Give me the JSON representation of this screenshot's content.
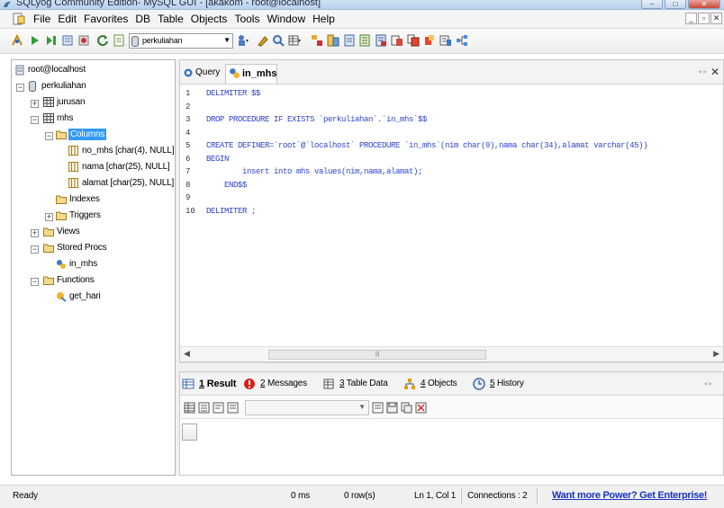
{
  "window": {
    "title": "SQLyog Community Edition- MySQL GUI - [akakom - root@localhost]",
    "controls": [
      "minimize",
      "maximize",
      "close"
    ]
  },
  "menu": {
    "items": [
      "File",
      "Edit",
      "Favorites",
      "DB",
      "Table",
      "Objects",
      "Tools",
      "Window",
      "Help"
    ],
    "mdi_controls": [
      "minimize",
      "restore",
      "close"
    ]
  },
  "toolbar": {
    "database_select": "perkuliahan",
    "icons": [
      "connect-icon",
      "execute-icon",
      "execute-all-icon",
      "execute-edit-icon",
      "stop-icon",
      "refresh-icon",
      "expand-icon",
      "db-user-icon",
      "format-icon",
      "search-icon",
      "table-data-icon",
      "schema-icon",
      "import-icon",
      "export-icon",
      "backup-icon",
      "restore-icon",
      "sync-icon",
      "copy-db-icon",
      "query-builder-icon",
      "schema-designer-icon"
    ]
  },
  "object_browser": {
    "connection": "root@localhost",
    "database": "perkuliahan",
    "tables": [
      {
        "name": "jurusan",
        "expanded": false
      },
      {
        "name": "mhs",
        "expanded": true
      }
    ],
    "columns_folder": "Columns",
    "columns": [
      "no_mhs [char(4), NULL]",
      "nama [char(25), NULL]",
      "alamat [char(25), NULL]"
    ],
    "indexes_folder": "Indexes",
    "triggers_folder": "Triggers",
    "views_folder": "Views",
    "procs_folder": "Stored Procs",
    "procs": [
      "in_mhs"
    ],
    "functions_folder": "Functions",
    "functions": [
      "get_hari"
    ]
  },
  "editor": {
    "tabs": [
      {
        "label": "Query",
        "active": false
      },
      {
        "label": "in_mhs",
        "active": true
      }
    ],
    "line_numbers": [
      "1",
      "2",
      "3",
      "4",
      "5",
      "6",
      "7",
      "8",
      "9",
      "10"
    ],
    "lines": [
      "DELIMITER $$",
      "",
      "DROP PROCEDURE IF EXISTS `perkuliahan`.`in_mhs`$$",
      "",
      "CREATE DEFINER=`root`@`localhost` PROCEDURE `in_mhs`(nim char(9),nama char(34),alamat varchar(45))",
      "BEGIN",
      "        insert into mhs values(nim,nama,alamat);",
      "    END$$",
      "",
      "DELIMITER ;"
    ]
  },
  "results": {
    "tabs": [
      {
        "number": "1",
        "label": "Result",
        "active": true
      },
      {
        "number": "2",
        "label": "Messages",
        "active": false
      },
      {
        "number": "3",
        "label": "Table Data",
        "active": false
      },
      {
        "number": "4",
        "label": "Objects",
        "active": false
      },
      {
        "number": "5",
        "label": "History",
        "active": false
      }
    ]
  },
  "status": {
    "state": "Ready",
    "time": "0 ms",
    "rows": "0 row(s)",
    "position": "Ln 1, Col 1",
    "connections": "Connections : 2",
    "promo_link": "Want more Power? Get Enterprise!"
  },
  "colors": {
    "code_keyword": "#2e43c8",
    "selection": "#3399ff",
    "link": "#1a33c4",
    "title_bar": "#b9d1ee"
  }
}
